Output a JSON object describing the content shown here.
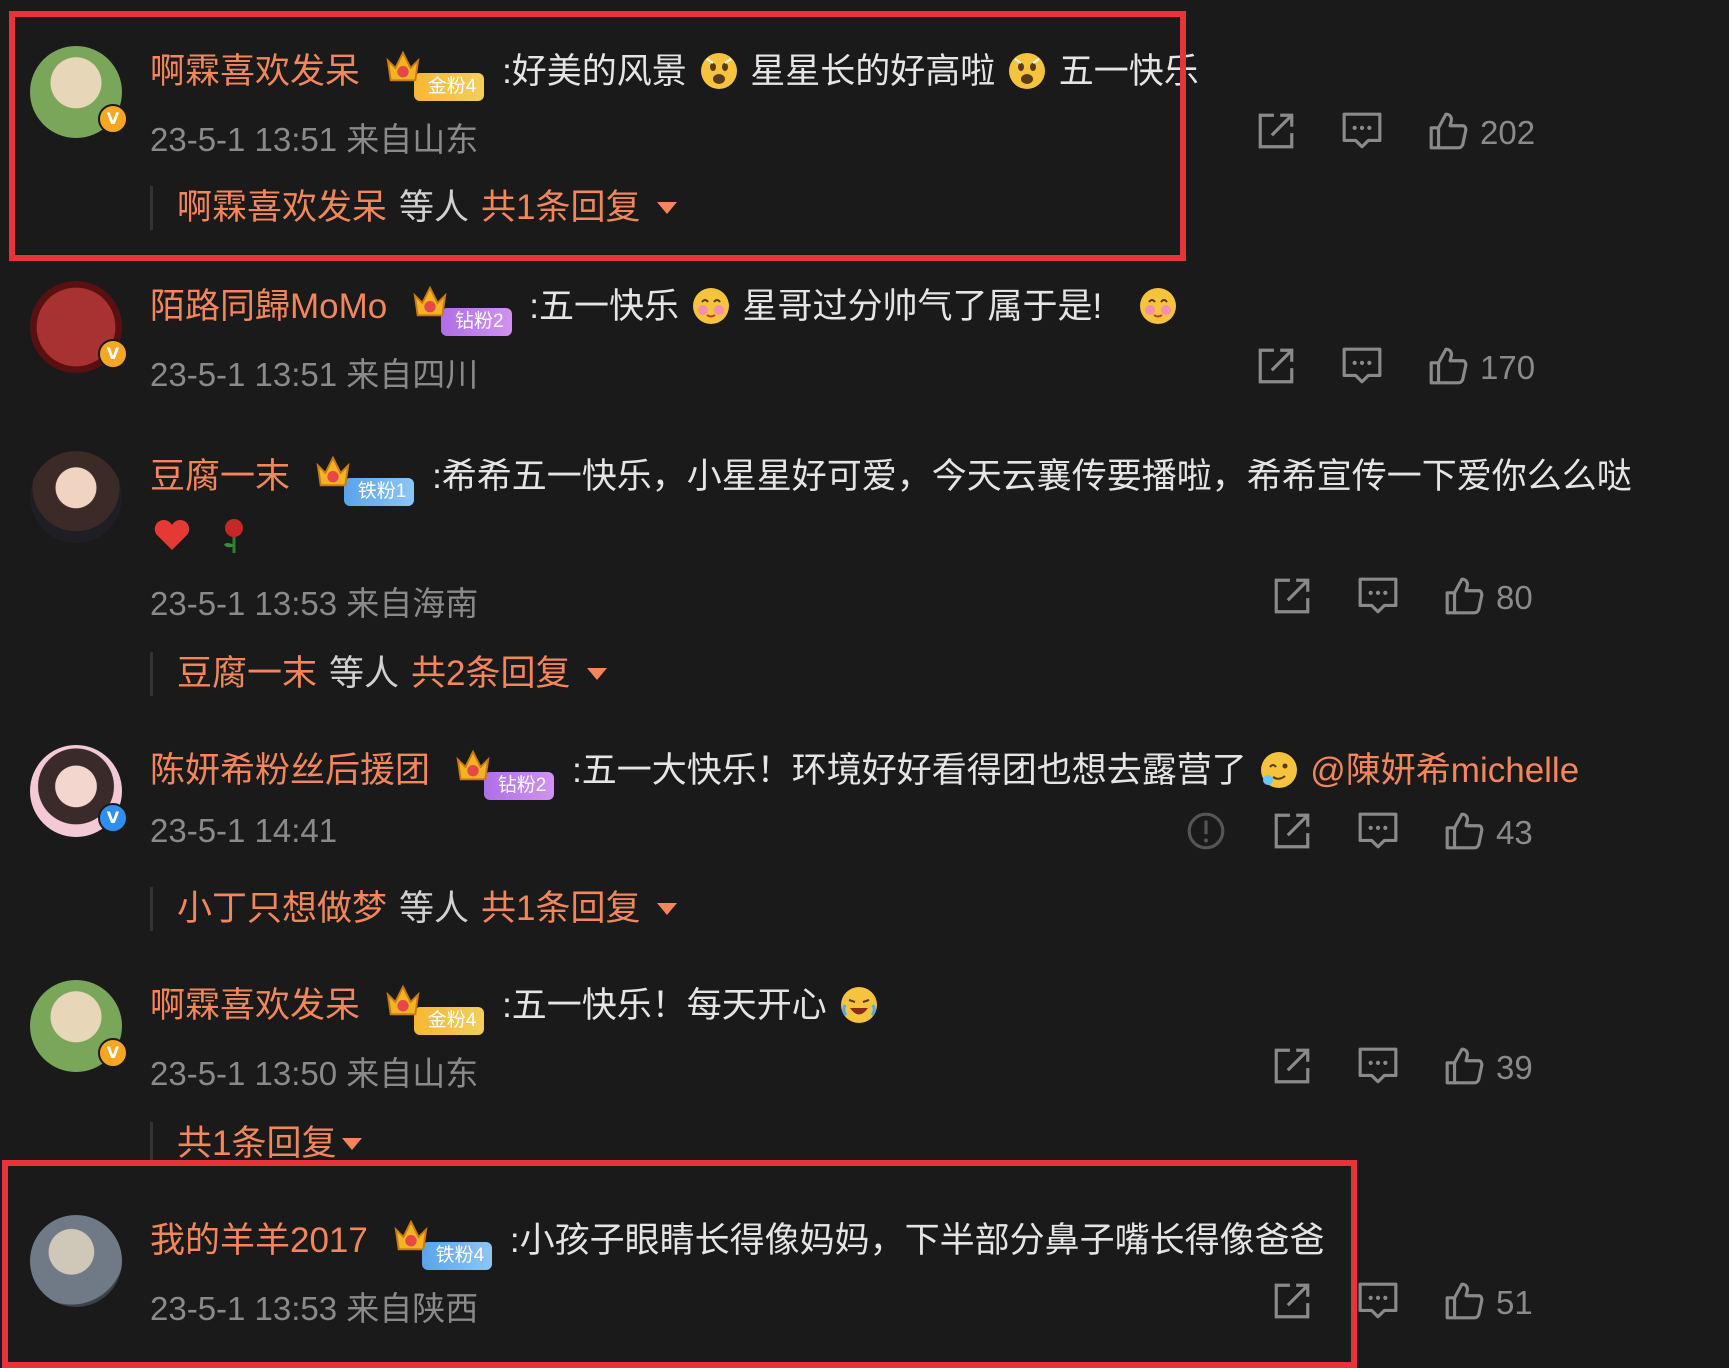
{
  "comments": [
    {
      "username": "啊霖喜欢发呆",
      "badge": "金粉4",
      "text_parts": [
        ":好美的风景",
        "星星长的好高啦",
        "五一快乐"
      ],
      "meta": "23-5-1 13:51 来自山东",
      "likes": "202",
      "reply": {
        "name": "啊霖喜欢发呆",
        "mid": "等人",
        "count": "共1条回复"
      }
    },
    {
      "username": "陌路同歸MoMo",
      "badge": "钻粉2",
      "text_parts": [
        ":五一快乐",
        "星哥过分帅气了属于是!"
      ],
      "meta": "23-5-1 13:51 来自四川",
      "likes": "170"
    },
    {
      "username": "豆腐一末",
      "badge": "铁粉1",
      "text_parts": [
        ":希希五一快乐，小星星好可爱，今天云襄传要播啦，希希宣传一下爱你么么哒"
      ],
      "meta": "23-5-1 13:53 来自海南",
      "likes": "80",
      "reply": {
        "name": "豆腐一末",
        "mid": "等人",
        "count": "共2条回复"
      }
    },
    {
      "username": "陈妍希粉丝后援团",
      "badge": "钻粉2",
      "text_parts": [
        ":五一大快乐！环境好好看得团也想去露营了",
        "@陳妍希michelle"
      ],
      "meta": "23-5-1 14:41",
      "likes": "43",
      "reply": {
        "name": "小丁只想做梦",
        "mid": "等人",
        "count": "共1条回复"
      }
    },
    {
      "username": "啊霖喜欢发呆",
      "badge": "金粉4",
      "text_parts": [
        ":五一快乐！每天开心"
      ],
      "meta": "23-5-1 13:50 来自山东",
      "likes": "39",
      "reply": {
        "count": "共1条回复"
      }
    },
    {
      "username": "我的羊羊2017",
      "badge": "铁粉4",
      "text_parts": [
        ":小孩子眼睛长得像妈妈，下半部分鼻子嘴长得像爸爸"
      ],
      "meta": "23-5-1 13:53 来自陕西",
      "likes": "51"
    }
  ],
  "colors": {
    "background": "#1a1a1a",
    "username": "#f3865a",
    "meta": "#8a8a8a",
    "highlight": "#e8333a"
  },
  "icons": [
    "share-icon",
    "comment-icon",
    "like-icon",
    "report-icon",
    "crown-icon",
    "verified-icon"
  ]
}
